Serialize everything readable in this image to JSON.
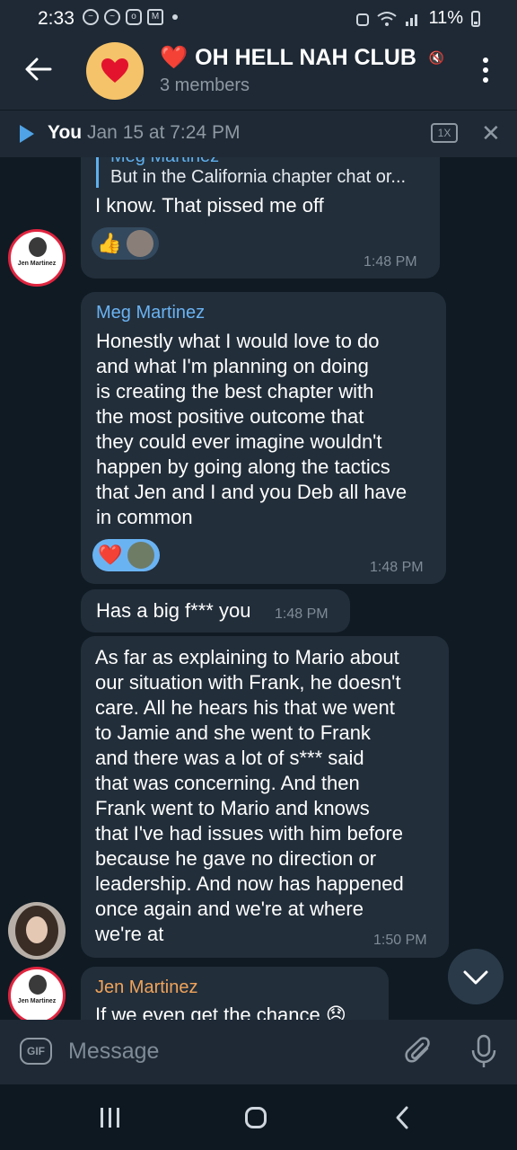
{
  "status": {
    "time": "2:33",
    "notif_icons": [
      "do-not-disturb-icon",
      "messenger-icon",
      "instagram-icon",
      "gmail-icon"
    ],
    "battery": "11%"
  },
  "header": {
    "title_emoji": "❤️",
    "title": "OH HELL NAH CLUB",
    "members": "3 members",
    "avatar_emoji": "❤️"
  },
  "player": {
    "name": "You",
    "date": "Jan 15 at 7:24 PM",
    "speed": "1X"
  },
  "messages": [
    {
      "reply_name": "Meg Martinez",
      "reply_text": "But in the California chapter chat or...",
      "text": "I know. That pissed me off",
      "time": "1:48 PM",
      "reaction": "👍"
    },
    {
      "sender": "Meg Martinez",
      "sender_color": "#6ab3f3",
      "lines": [
        "Honestly what I would love to do",
        "and what I'm planning on doing",
        "is creating the best chapter with",
        "the most positive outcome that",
        "they could ever imagine wouldn't",
        "happen by going along the tactics",
        "that Jen and I and you Deb all have",
        "in common"
      ],
      "time": "1:48 PM",
      "reaction": "❤️"
    },
    {
      "text": "Has a big f*** you",
      "time": "1:48 PM"
    },
    {
      "lines": [
        "As far as explaining to Mario about",
        "our situation with Frank, he doesn't",
        "care. All he hears his that we went",
        "to Jamie and she went to Frank",
        "and there was a lot of s*** said",
        "that was concerning. And then",
        "Frank went to Mario and knows",
        "that I've had issues with him before",
        "because he gave no direction or",
        "leadership. And now has happened",
        "once again and we're at where",
        "we're at"
      ],
      "time": "1:50 PM"
    },
    {
      "sender": "Jen Martinez",
      "sender_color": "#f0a35a",
      "text": "If we even get the chance 😞"
    }
  ],
  "avatars": {
    "jen_label": "Jen Martinez"
  },
  "input": {
    "gif_label": "GIF",
    "placeholder": "Message"
  }
}
